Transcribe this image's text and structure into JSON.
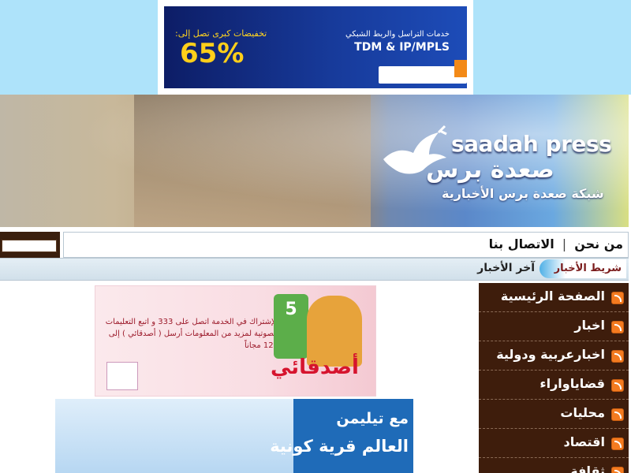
{
  "top_ad": {
    "discount_label": "تخفيضات كبرى تصل إلى:",
    "discount_value": "65%",
    "service_text": "خدمات التراسل والربط الشبكي",
    "tech_text": "TDM & IP/MPLS"
  },
  "banner": {
    "logo_latin": "saadah press",
    "logo_arabic": "صعدة برس",
    "tagline": "شبكة صعدة برس الأخبارية"
  },
  "nav": {
    "items": [
      "من نحن",
      "الاتصال بنا"
    ],
    "separator": "|"
  },
  "ticker": {
    "badge": "شريط الأخبار",
    "latest": "آخر الأخبار"
  },
  "mid_ad": {
    "text": "للإشتراك في الخدمة اتصل على 333 و اتبع التعليمات الصوتية لمزيد من المعلومات أرسل ( أصدقائي ) إلى 123 مجاناً",
    "phone_number": "5",
    "brand": "أصدقائي"
  },
  "bottom_ad": {
    "line1": "مع تيليمن",
    "line2": "العالم قرية كونية"
  },
  "sidebar": {
    "items": [
      {
        "label": "الصفحة الرئيسية"
      },
      {
        "label": "اخبار"
      },
      {
        "label": "اخبارعربية ودولية"
      },
      {
        "label": "قضاياواراء"
      },
      {
        "label": "محليات"
      },
      {
        "label": "اقتصاد"
      },
      {
        "label": "ثقافة"
      }
    ]
  },
  "colors": {
    "sidebar_bg": "#3e1d0c",
    "top_strip": "#aee3fa",
    "rss": "#f47b20"
  }
}
